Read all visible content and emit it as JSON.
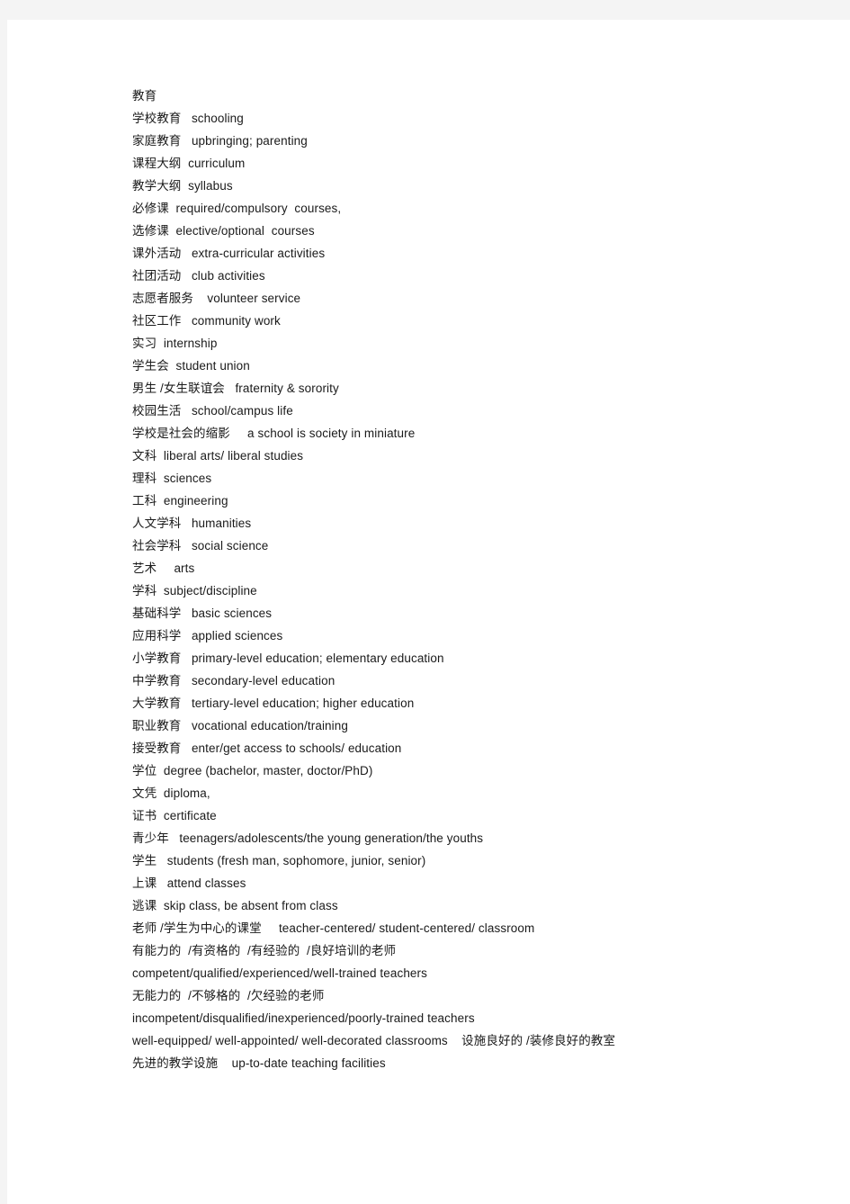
{
  "document": {
    "title": "教育",
    "text_color": "#1a1a1a",
    "page_background": "#ffffff",
    "canvas_background": "#f4f4f4",
    "lines": [
      "教育",
      "学校教育   schooling",
      "家庭教育   upbringing; parenting",
      "课程大纲  curriculum",
      "教学大纲  syllabus",
      "必修课  required/compulsory  courses,",
      "选修课  elective/optional  courses",
      "课外活动   extra-curricular activities",
      "社团活动   club activities",
      "志愿者服务    volunteer service",
      "社区工作   community work",
      "实习  internship",
      "学生会  student union",
      "男生 /女生联谊会   fraternity & sorority",
      "校园生活   school/campus life",
      "学校是社会的缩影     a school is society in miniature",
      "文科  liberal arts/ liberal studies",
      "理科  sciences",
      "工科  engineering",
      "人文学科   humanities",
      "社会学科   social science",
      "艺术     arts",
      "学科  subject/discipline",
      "基础科学   basic sciences",
      "应用科学   applied sciences",
      "小学教育   primary-level education; elementary education",
      "中学教育   secondary-level education",
      "大学教育   tertiary-level education; higher education",
      "职业教育   vocational education/training",
      "接受教育   enter/get access to schools/ education",
      "学位  degree (bachelor, master, doctor/PhD)",
      "文凭  diploma,",
      "证书  certificate",
      "青少年   teenagers/adolescents/the young generation/the youths",
      "学生   students (fresh man, sophomore, junior, senior)",
      "上课   attend classes",
      "逃课  skip class, be absent from class",
      "老师 /学生为中心的课堂     teacher-centered/ student-centered/ classroom",
      "有能力的  /有资格的  /有经验的  /良好培训的老师",
      "competent/qualified/experienced/well-trained teachers",
      "无能力的  /不够格的  /欠经验的老师",
      "incompetent/disqualified/inexperienced/poorly-trained teachers",
      "well-equipped/ well-appointed/ well-decorated classrooms    设施良好的 /装修良好的教室",
      "先进的教学设施    up-to-date teaching facilities"
    ]
  }
}
